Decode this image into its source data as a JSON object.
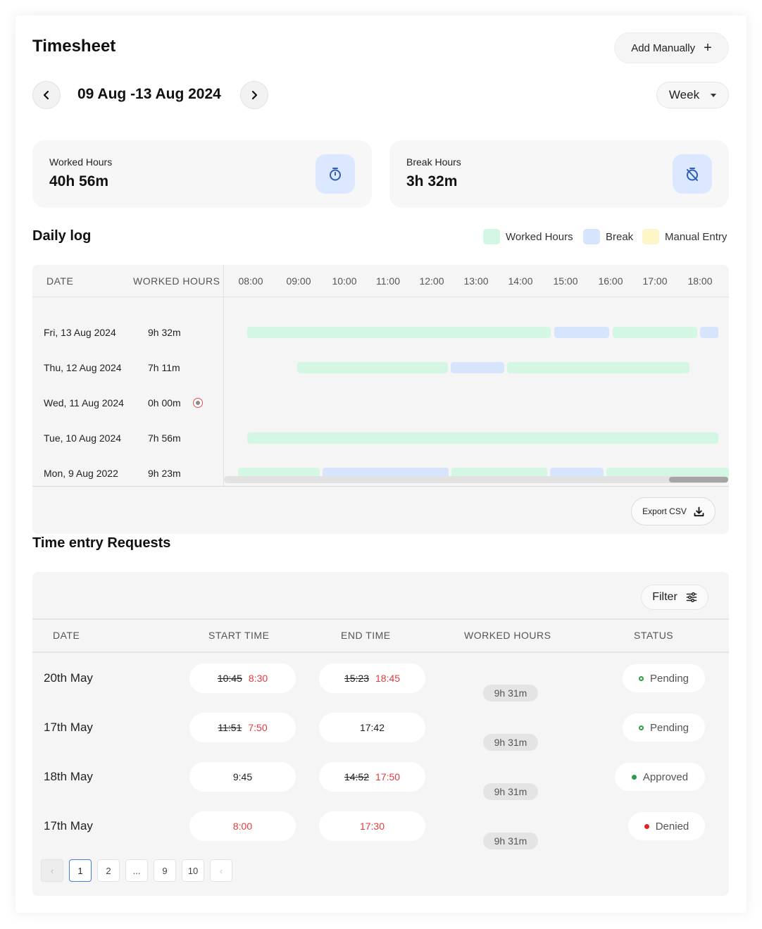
{
  "header": {
    "title": "Timesheet",
    "add_manually_label": "Add Manually",
    "add_icon": "+",
    "date_range": "09 Aug -13 Aug 2024",
    "period_select": "Week"
  },
  "stats": {
    "worked_label": "Worked Hours",
    "worked_value": "40h 56m",
    "break_label": "Break Hours",
    "break_value": "3h 32m"
  },
  "daily_log": {
    "title": "Daily log",
    "legend": [
      {
        "label": "Worked Hours",
        "color": "#d3f7e2"
      },
      {
        "label": "Break",
        "color": "#d7e5fc"
      },
      {
        "label": "Manual Entry",
        "color": "#fdf6c9"
      }
    ],
    "columns": {
      "date": "DATE",
      "worked_hours": "WORKED HOURS"
    },
    "times": [
      "08:00",
      "09:00",
      "10:00",
      "11:00",
      "12:00",
      "13:00",
      "14:00",
      "15:00",
      "16:00",
      "17:00",
      "18:00"
    ],
    "rows": [
      {
        "date": "Fri, 13 Aug 2024",
        "hours": "9h 32m"
      },
      {
        "date": "Thu, 12 Aug 2024",
        "hours": "7h 11m"
      },
      {
        "date": "Wed, 11 Aug 2024",
        "hours": "0h 00m"
      },
      {
        "date": "Tue, 10 Aug 2024",
        "hours": "7h 56m"
      },
      {
        "date": "Mon, 9 Aug 2022",
        "hours": "9h 23m"
      }
    ],
    "export_label": "Export CSV"
  },
  "requests": {
    "title": "Time entry Requests",
    "filter_label": "Filter",
    "columns": {
      "date": "DATE",
      "start": "START TIME",
      "end": "END TIME",
      "worked": "WORKED HOURS",
      "status": "STATUS"
    },
    "rows": [
      {
        "date": "20th May",
        "start_old": "10:45",
        "start_new": "8:30",
        "end_old": "15:23",
        "end_new": "18:45",
        "worked": "9h 31m",
        "status": "Pending"
      },
      {
        "date": "17th May",
        "start_old": "11:51",
        "start_new": "7:50",
        "end": "17:42",
        "worked": "9h 31m",
        "status": "Pending"
      },
      {
        "date": "18th May",
        "start": "9:45",
        "end_old": "14:52",
        "end_new": "17:50",
        "worked": "9h 31m",
        "status": "Approved"
      },
      {
        "date": "17th May",
        "start": "8:00",
        "end": "17:30",
        "worked": "9h 31m",
        "status": "Denied"
      }
    ],
    "pagination": {
      "pages": [
        "1",
        "2",
        "...",
        "9",
        "10"
      ],
      "prev": "‹",
      "next": "‹"
    }
  }
}
